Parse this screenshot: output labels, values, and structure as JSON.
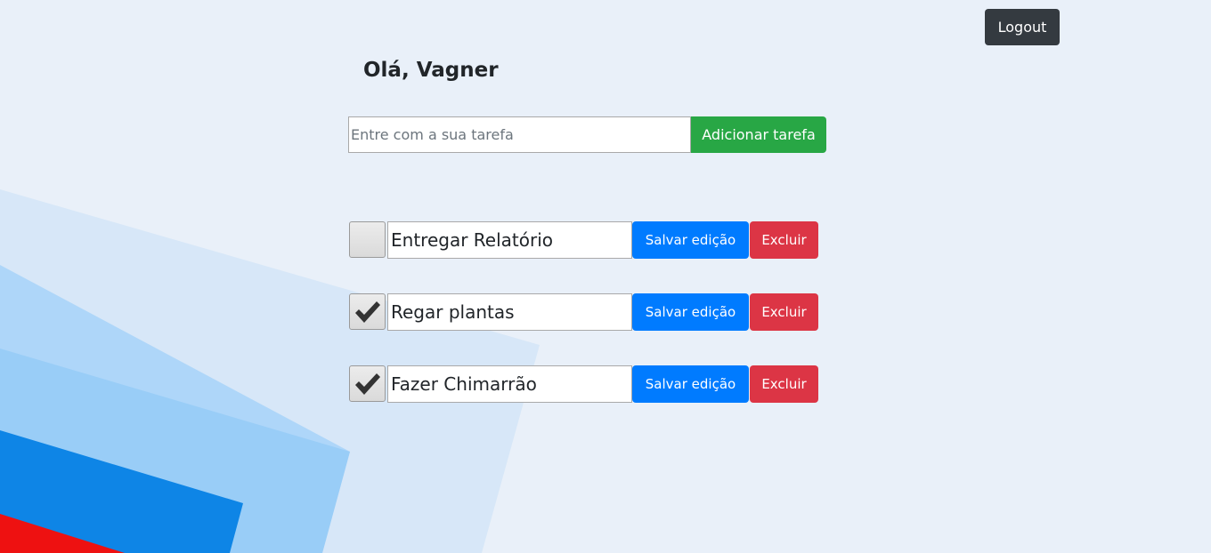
{
  "header": {
    "logout_label": "Logout"
  },
  "greeting": "Olá, Vagner",
  "new_task": {
    "placeholder": "Entre com a sua tarefa",
    "value": "",
    "add_label": "Adicionar tarefa"
  },
  "tasks": [
    {
      "text": "Entregar Relatório",
      "checked": false,
      "save_label": "Salvar edição",
      "delete_label": "Excluir"
    },
    {
      "text": "Regar plantas",
      "checked": true,
      "save_label": "Salvar edição",
      "delete_label": "Excluir"
    },
    {
      "text": "Fazer Chimarrão",
      "checked": true,
      "save_label": "Salvar edição",
      "delete_label": "Excluir"
    }
  ],
  "colors": {
    "background": "#e9f0f9",
    "logout": "#343a40",
    "add": "#28a745",
    "save": "#007bff",
    "delete": "#dc3545"
  },
  "icons": {
    "checkbox_checked": "checkmark-icon"
  }
}
